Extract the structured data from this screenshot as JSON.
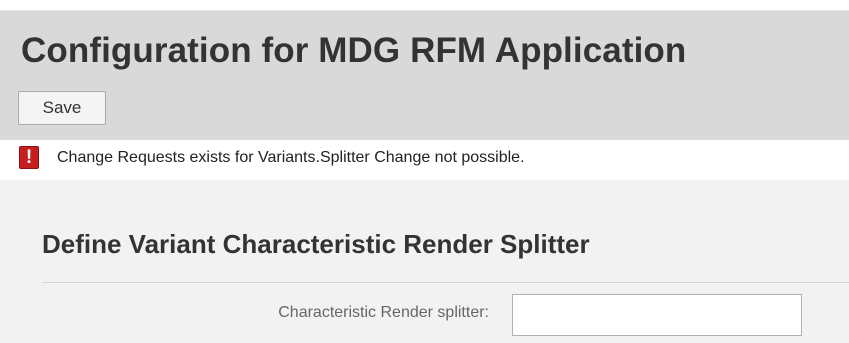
{
  "header": {
    "title": "Configuration for MDG RFM Application",
    "save_label": "Save"
  },
  "message": {
    "type": "error",
    "icon": "error-exclamation-icon",
    "icon_glyph": "!",
    "text": "Change Requests exists for Variants.Splitter Change not possible."
  },
  "section": {
    "title": "Define Variant Characteristic Render Splitter"
  },
  "form": {
    "splitter_label": "Characteristic Render splitter:",
    "splitter_value": ""
  },
  "colors": {
    "header_background": "#d9d9d9",
    "page_background": "#f2f2f2",
    "error_icon": "#c41e1e"
  }
}
